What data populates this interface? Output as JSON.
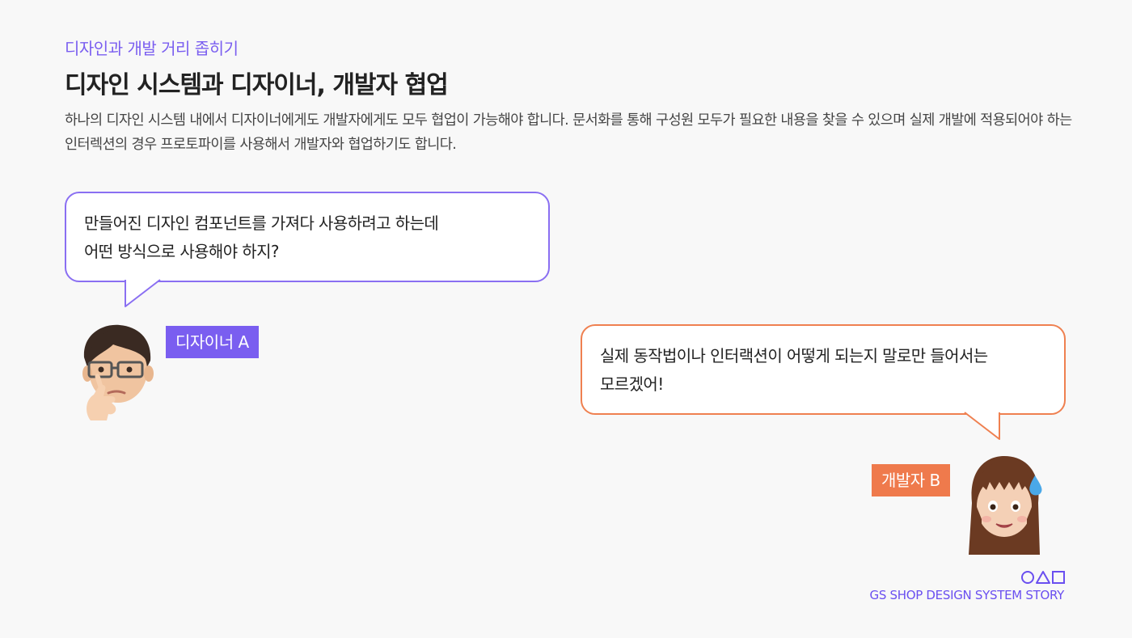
{
  "header": {
    "eyebrow": "디자인과 개발 거리 좁히기",
    "title": "디자인 시스템과 디자이너, 개발자 협업",
    "description": "하나의 디자인 시스템 내에서 디자이너에게도 개발자에게도 모두 협업이 가능해야 합니다. 문서화를 통해 구성원 모두가 필요한 내용을 찾을 수 있으며 실제 개발에 적용되어야 하는 인터렉션의 경우 프로토파이를 사용해서 개발자와 협업하기도 합니다."
  },
  "conversation": {
    "designer": {
      "lines": [
        "만들어진 디자인 컴포넌트를 가져다 사용하려고 하는데",
        "어떤 방식으로 사용해야 하지?"
      ],
      "name": "디자이너 A",
      "color": "#7a5ef0",
      "avatar_icon": "memoji-man-glasses-thinking"
    },
    "developer": {
      "lines": [
        "실제 동작법이나 인터랙션이 어떻게 되는지 말로만 들어서는",
        "모르겠어!"
      ],
      "name": "개발자 B",
      "color": "#ef7a4c",
      "avatar_icon": "memoji-woman-sweat-drop"
    }
  },
  "footer": {
    "shape_icons": [
      "circle-icon",
      "triangle-icon",
      "square-icon"
    ],
    "brand": "GS SHOP DESIGN SYSTEM STORY",
    "color": "#6a4ff0"
  }
}
